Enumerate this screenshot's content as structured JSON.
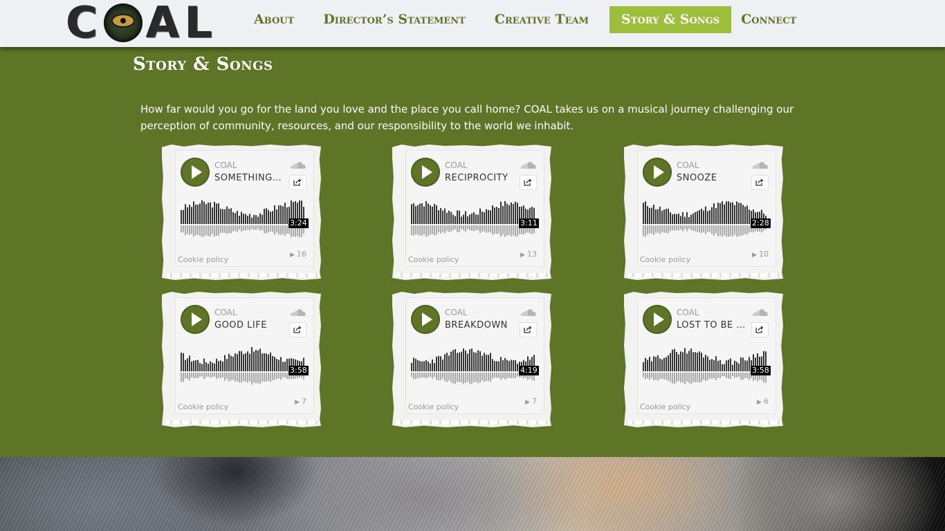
{
  "header": {
    "logo_alt": "COAL",
    "logo_letters": [
      "C",
      "A",
      "L"
    ],
    "nav": [
      {
        "label": "About",
        "active": false
      },
      {
        "label": "Director’s Statement",
        "active": false
      },
      {
        "label": "Creative Team",
        "active": false
      },
      {
        "label": "Story & Songs",
        "active": true
      },
      {
        "label": "Connect",
        "active": false
      }
    ]
  },
  "section": {
    "title": "Story & Songs",
    "intro": "How far would you go for the land you love and the place you call home? COAL takes us on a musical journey challenging our perception of community, resources, and our responsibility to the world we inhabit."
  },
  "tracks": [
    {
      "artist": "COAL",
      "title": "SOMETHING ...",
      "duration": "3:24",
      "plays": "16",
      "cookie": "Cookie policy"
    },
    {
      "artist": "COAL",
      "title": "RECIPROCITY",
      "duration": "3:11",
      "plays": "13",
      "cookie": "Cookie policy"
    },
    {
      "artist": "COAL",
      "title": "SNOOZE",
      "duration": "2:28",
      "plays": "10",
      "cookie": "Cookie policy"
    },
    {
      "artist": "COAL",
      "title": "GOOD LIFE",
      "duration": "3:58",
      "plays": "7",
      "cookie": "Cookie policy"
    },
    {
      "artist": "COAL",
      "title": "BREAKDOWN",
      "duration": "4:19",
      "plays": "7",
      "cookie": "Cookie policy"
    },
    {
      "artist": "COAL",
      "title": "LOST TO BE ...",
      "duration": "3:58",
      "plays": "6",
      "cookie": "Cookie policy"
    }
  ],
  "colors": {
    "brand_green": "#5e7427",
    "nav_active_bg": "#9dbd3d",
    "header_bg": "#eff0f4"
  },
  "icons": {
    "play": "play-icon",
    "share": "share-icon",
    "soundcloud": "soundcloud-icon",
    "plays": "play-count-icon"
  }
}
